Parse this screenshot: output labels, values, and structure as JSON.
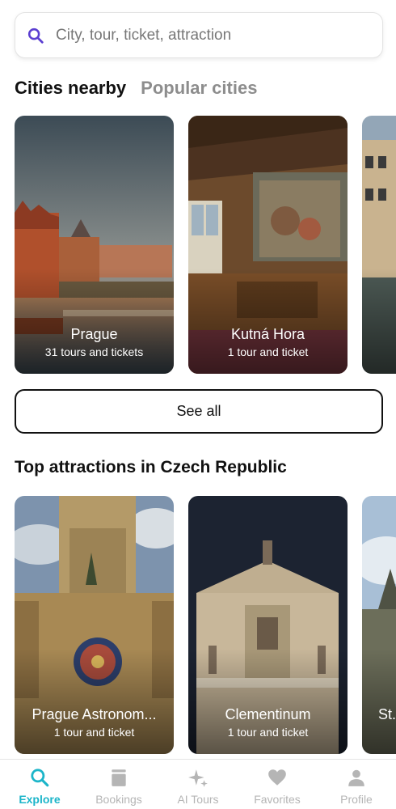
{
  "search": {
    "placeholder": "City, tour, ticket, attraction"
  },
  "tabs": [
    {
      "label": "Cities nearby",
      "active": true
    },
    {
      "label": "Popular cities",
      "active": false
    }
  ],
  "cities": [
    {
      "title": "Prague",
      "subtitle": "31 tours and tickets"
    },
    {
      "title": "Kutná Hora",
      "subtitle": "1 tour and ticket"
    }
  ],
  "see_all_label": "See all",
  "attractions_section": {
    "title": "Top attractions in Czech Republic"
  },
  "attractions": [
    {
      "title": "Prague Astronom...",
      "subtitle": "1 tour and ticket"
    },
    {
      "title": "Clementinum",
      "subtitle": "1 tour and ticket"
    },
    {
      "title": "St."
    }
  ],
  "nav": [
    {
      "label": "Explore",
      "icon": "search-icon",
      "active": true
    },
    {
      "label": "Bookings",
      "icon": "bookings-icon",
      "active": false
    },
    {
      "label": "AI Tours",
      "icon": "sparkle-icon",
      "active": false
    },
    {
      "label": "Favorites",
      "icon": "heart-icon",
      "active": false
    },
    {
      "label": "Profile",
      "icon": "person-icon",
      "active": false
    }
  ],
  "colors": {
    "accent": "#1cb5c9",
    "search_icon": "#5b3fd1",
    "inactive": "#b5b5b5"
  }
}
